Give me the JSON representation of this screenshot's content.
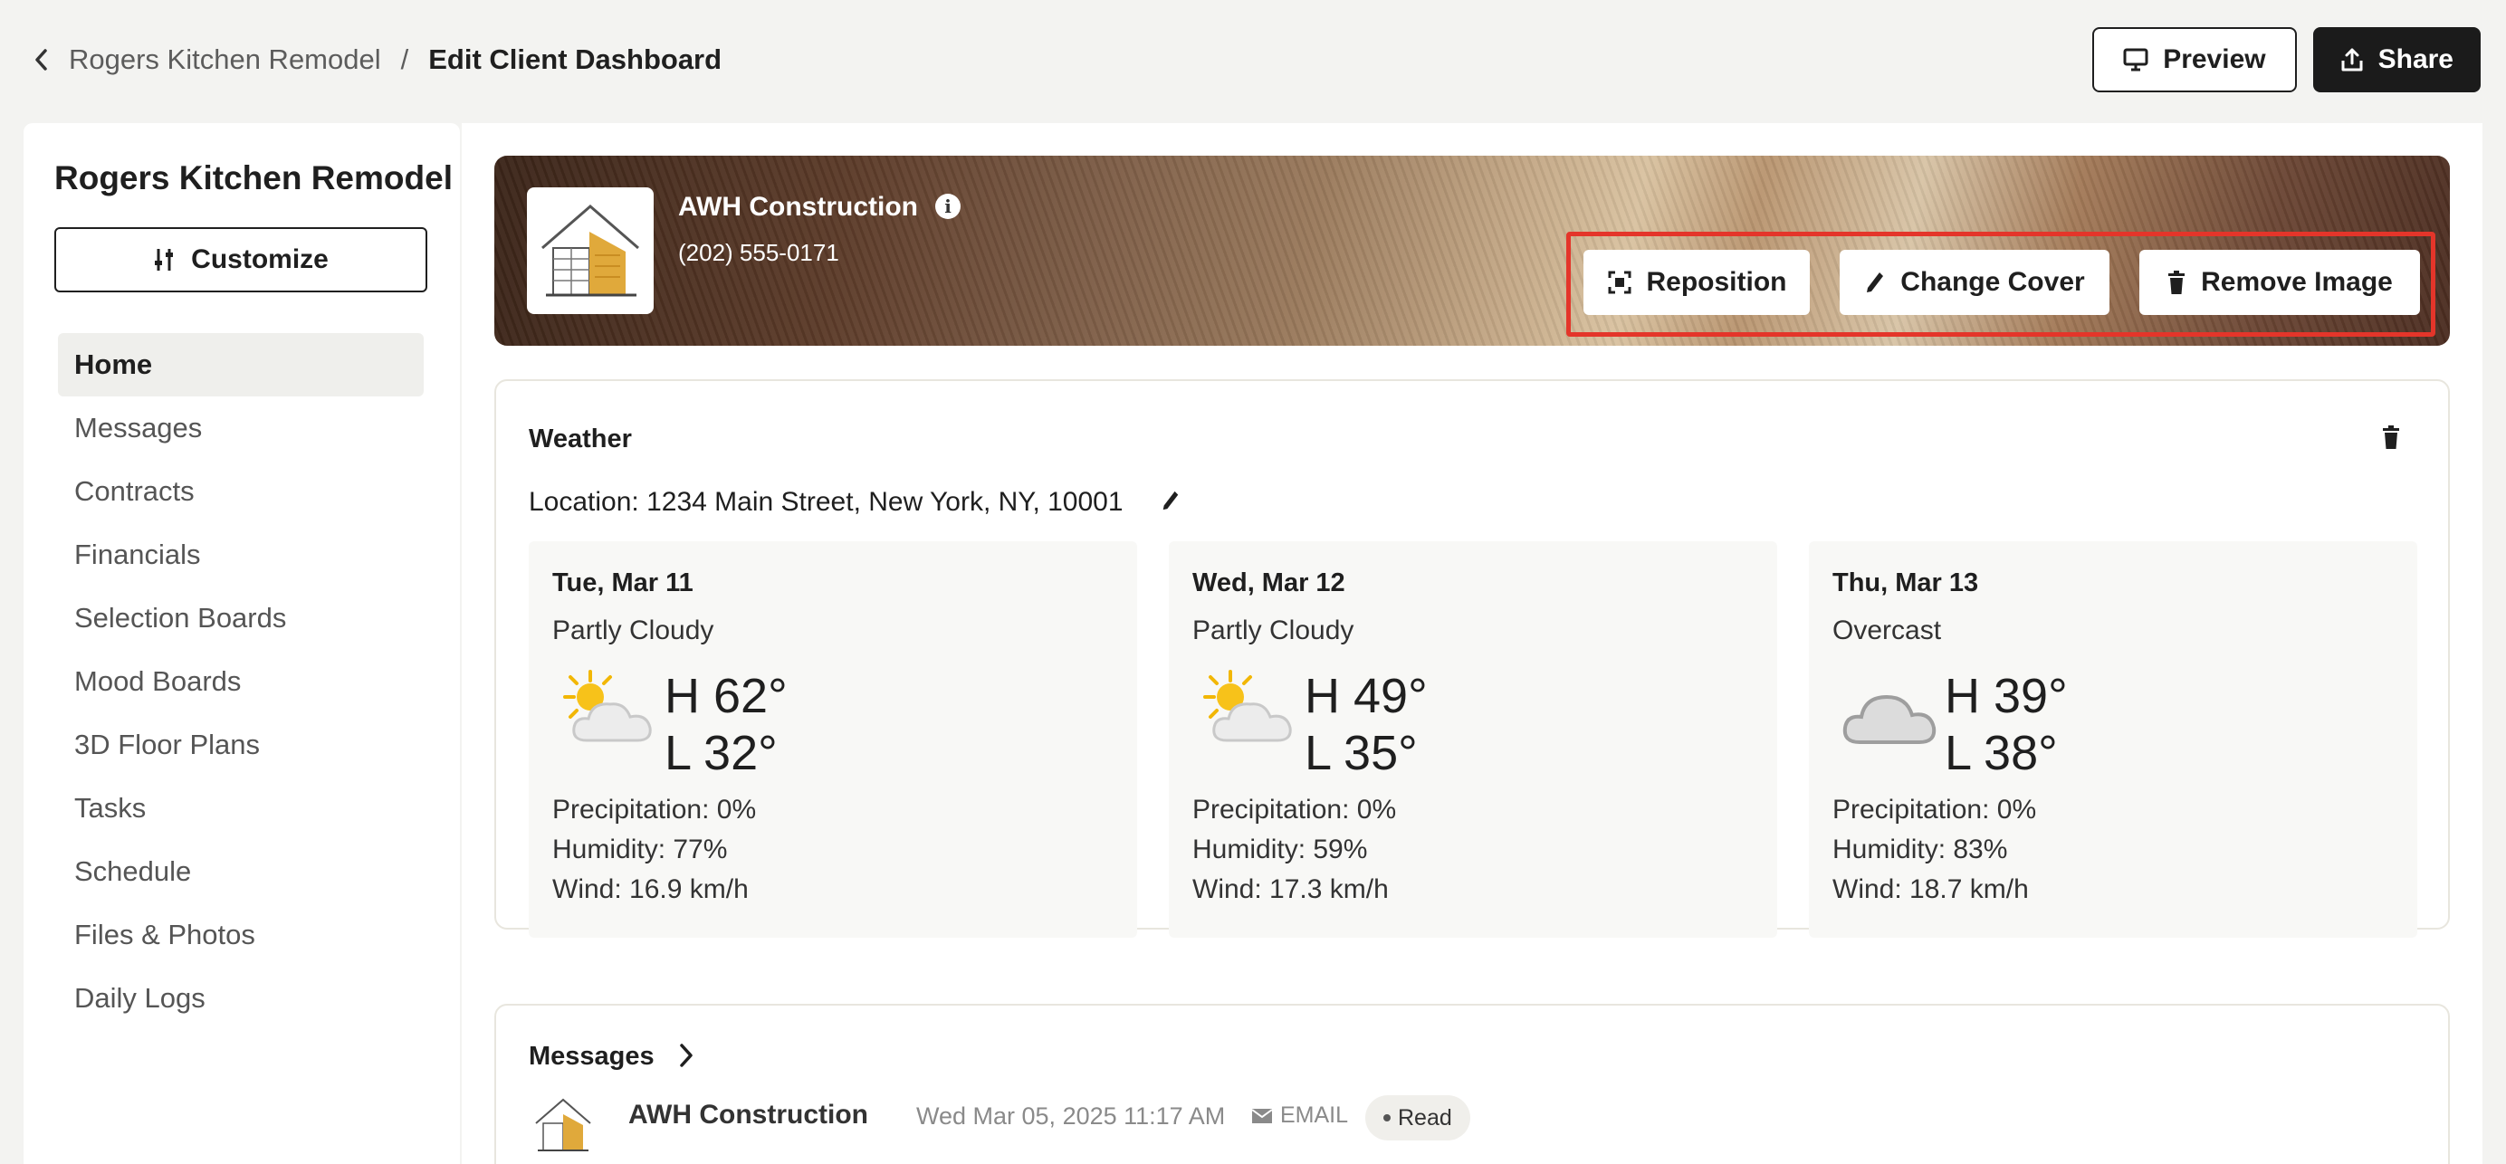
{
  "breadcrumb": {
    "parent": "Rogers Kitchen Remodel",
    "separator": "/",
    "current": "Edit Client Dashboard"
  },
  "header_actions": {
    "preview_label": "Preview",
    "share_label": "Share"
  },
  "sidebar": {
    "project_title": "Rogers Kitchen Remodel",
    "customize_label": "Customize",
    "items": [
      {
        "label": "Home",
        "active": true
      },
      {
        "label": "Messages"
      },
      {
        "label": "Contracts"
      },
      {
        "label": "Financials"
      },
      {
        "label": "Selection Boards"
      },
      {
        "label": "Mood Boards"
      },
      {
        "label": "3D Floor Plans"
      },
      {
        "label": "Tasks"
      },
      {
        "label": "Schedule"
      },
      {
        "label": "Files & Photos"
      },
      {
        "label": "Daily Logs"
      }
    ]
  },
  "cover": {
    "company_name": "AWH Construction",
    "phone": "(202) 555-0171",
    "reposition_label": "Reposition",
    "change_cover_label": "Change Cover",
    "remove_image_label": "Remove Image",
    "highlight_color": "#e4352a"
  },
  "weather": {
    "title": "Weather",
    "location": "Location: 1234 Main Street, New York, NY, 10001",
    "days": [
      {
        "date": "Tue, Mar 11",
        "condition": "Partly Cloudy",
        "icon": "partly-cloudy-icon",
        "high": "H 62°",
        "low": "L 32°",
        "precipitation": "Precipitation: 0%",
        "humidity": "Humidity: 77%",
        "wind": "Wind: 16.9 km/h"
      },
      {
        "date": "Wed, Mar 12",
        "condition": "Partly Cloudy",
        "icon": "partly-cloudy-icon",
        "high": "H 49°",
        "low": "L 35°",
        "precipitation": "Precipitation: 0%",
        "humidity": "Humidity: 59%",
        "wind": "Wind: 17.3 km/h"
      },
      {
        "date": "Thu, Mar 13",
        "condition": "Overcast",
        "icon": "overcast-icon",
        "high": "H 39°",
        "low": "L 38°",
        "precipitation": "Precipitation: 0%",
        "humidity": "Humidity: 83%",
        "wind": "Wind: 18.7 km/h"
      }
    ]
  },
  "messages": {
    "title": "Messages",
    "latest": {
      "from": "AWH Construction",
      "date": "Wed Mar 05, 2025 11:17 AM",
      "channel": "EMAIL",
      "status": "Read"
    }
  }
}
